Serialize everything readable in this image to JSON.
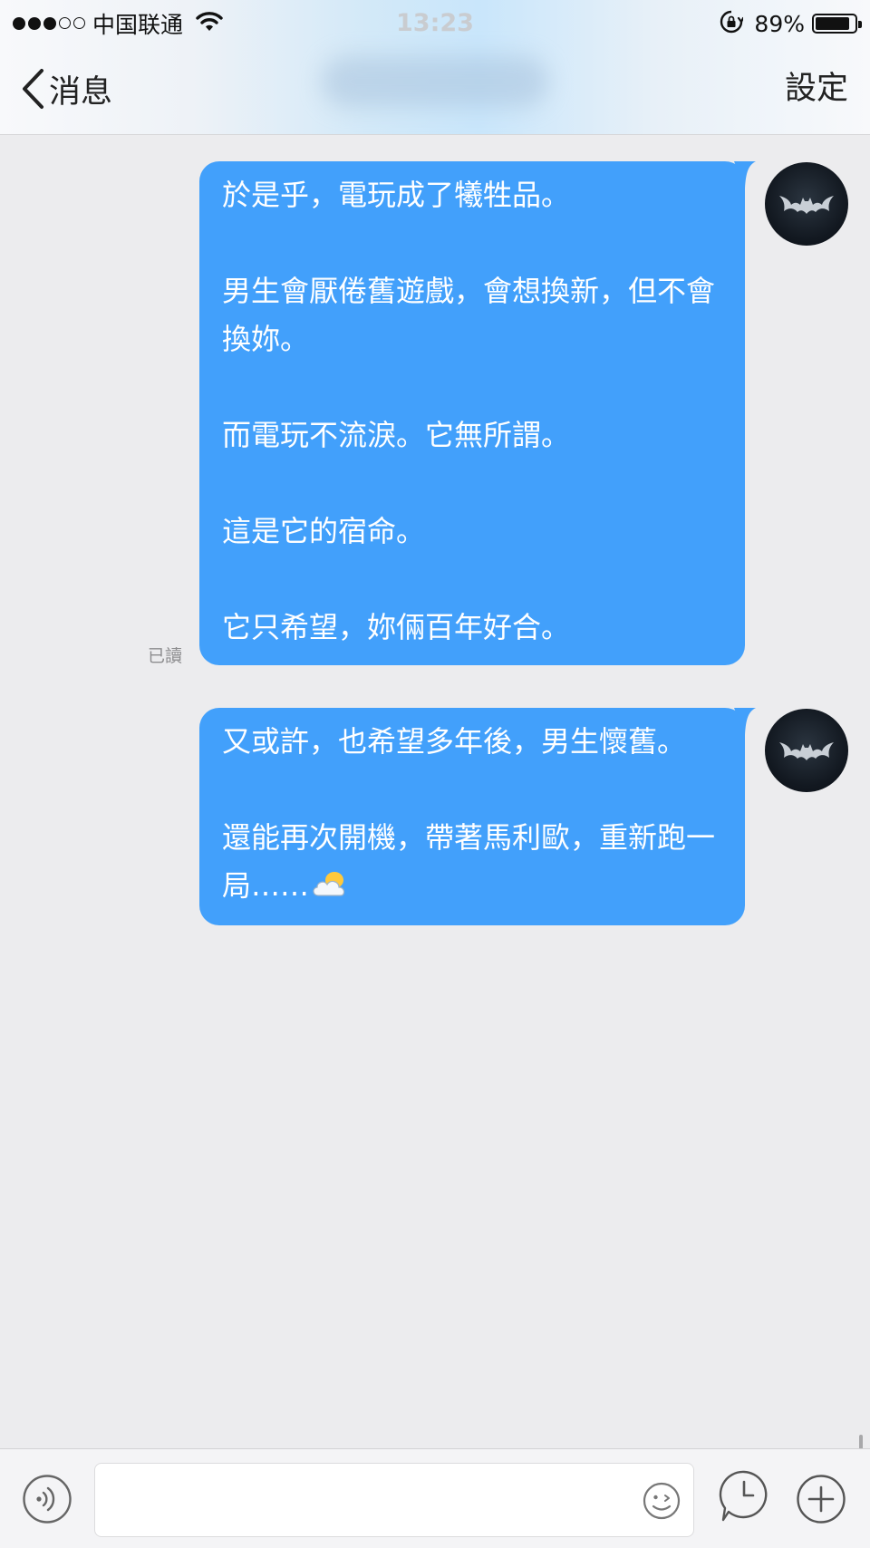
{
  "status_bar": {
    "signal_dots_filled": 3,
    "signal_dots_total": 5,
    "carrier": "中国联通",
    "time": "13:23",
    "battery_percent": "89%",
    "battery_level": 0.89
  },
  "nav": {
    "back_label": "消息",
    "right_label": "設定"
  },
  "messages": [
    {
      "paragraphs": [
        "於是乎，電玩成了犧牲品。",
        "男生會厭倦舊遊戲，會想換新，但不會換妳。",
        "而電玩不流淚。它無所謂。",
        "這是它的宿命。",
        "它只希望，妳倆百年好合。"
      ],
      "read_label": "已讀"
    },
    {
      "paragraphs": [
        "又或許，也希望多年後，男生懷舊。",
        "還能再次開機，帶著馬利歐，重新跑一局……"
      ],
      "trailing_emoji": "cloud-emoji"
    }
  ],
  "input_bar": {
    "placeholder": "",
    "icons": [
      "voice-icon",
      "emoji-icon",
      "clock-icon",
      "plus-icon"
    ]
  },
  "colors": {
    "bubble": "#42a0fb",
    "background": "#ececee",
    "header_tint": "#c9e6fb"
  }
}
